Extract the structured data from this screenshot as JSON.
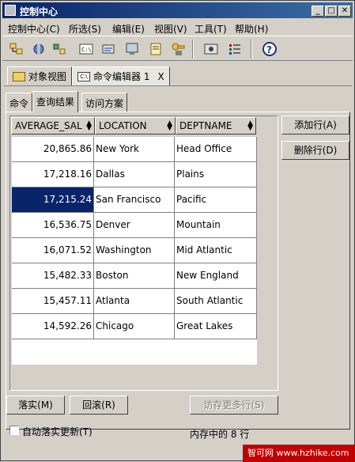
{
  "window": {
    "title": "控制中心"
  },
  "menu": [
    "控制中心(C)",
    "所选(S)",
    "编辑(E)",
    "视图(V)",
    "工具(T)",
    "帮助(H)"
  ],
  "doc_tabs": [
    {
      "label": "对象视图"
    },
    {
      "label": "命令编辑器 1"
    }
  ],
  "sub_tabs": [
    "命令",
    "查询结果",
    "访问方案"
  ],
  "table": {
    "columns": [
      "AVERAGE_SAL",
      "LOCATION",
      "DEPTNAME"
    ],
    "rows": [
      [
        "20,865.86",
        "New York",
        "Head Office"
      ],
      [
        "17,218.16",
        "Dallas",
        "Plains"
      ],
      [
        "17,215.24",
        "San Francisco",
        "Pacific"
      ],
      [
        "16,536.75",
        "Denver",
        "Mountain"
      ],
      [
        "16,071.52",
        "Washington",
        "Mid Atlantic"
      ],
      [
        "15,482.33",
        "Boston",
        "New England"
      ],
      [
        "15,457.11",
        "Atlanta",
        "South Atlantic"
      ],
      [
        "14,592.26",
        "Chicago",
        "Great Lakes"
      ]
    ]
  },
  "side_buttons": {
    "add_row": "添加行(A)",
    "delete_row": "删除行(D)"
  },
  "bottom": {
    "commit": "落实(M)",
    "rollback": "回滚(R)",
    "fetch_more": "访存更多行(S)",
    "auto_commit": "自动落实更新(T)",
    "rows_in_memory": "内存中的 8 行"
  },
  "watermark": "智可网 www.hzhike.com",
  "colors": {
    "title_bar": "#0a246a",
    "selection": "#0a246a",
    "face": "#d4d0c8"
  }
}
